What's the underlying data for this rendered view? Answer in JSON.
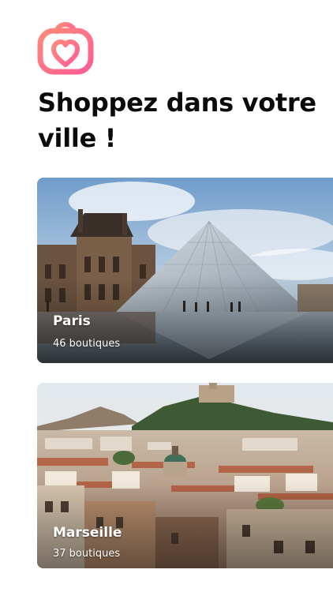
{
  "brand": {
    "logo_icon": "shopping-bag-heart-icon",
    "gradient_start": "#ff7a7a",
    "gradient_end": "#ff5f9a"
  },
  "headline": "Shoppez dans votre ville !",
  "cities": [
    {
      "name": "Paris",
      "count": "46 boutiques",
      "photo": "louvre-pyramid-photo"
    },
    {
      "name": "Marseille",
      "count": "37 boutiques",
      "photo": "marseille-cityscape-photo"
    }
  ]
}
